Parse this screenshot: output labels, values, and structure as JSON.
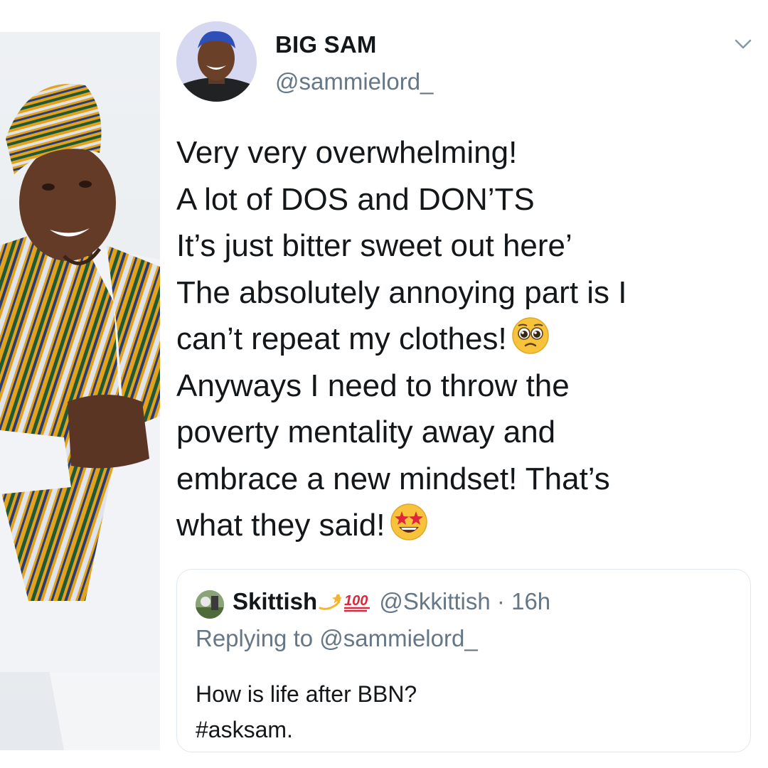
{
  "tweet": {
    "author_name": "BIG SAM",
    "author_handle": "@sammielord_",
    "lines": [
      "Very very overwhelming!",
      "A lot of DOS and DON’TS",
      "It’s just bitter sweet out here’",
      "The absolutely annoying part is I",
      "can’t repeat my clothes!",
      "Anyways I need to throw the",
      "poverty mentality away and",
      "embrace a new mindset! That’s",
      "what they said!"
    ],
    "emojis": [
      "pleading-face-emoji",
      "star-struck-emoji"
    ]
  },
  "quoted_tweet": {
    "author_name": "Skittish",
    "author_handle": "@Skkittish",
    "separator": "·",
    "time": "16h",
    "reply_prefix": "Replying to",
    "reply_to": "@sammielord_",
    "body_lines": [
      "How is life after BBN?",
      "#asksam."
    ],
    "name_decorations": [
      "dizzy-icon",
      "hundred-points-icon"
    ]
  },
  "icons": {
    "menu": "chevron-down-icon"
  }
}
